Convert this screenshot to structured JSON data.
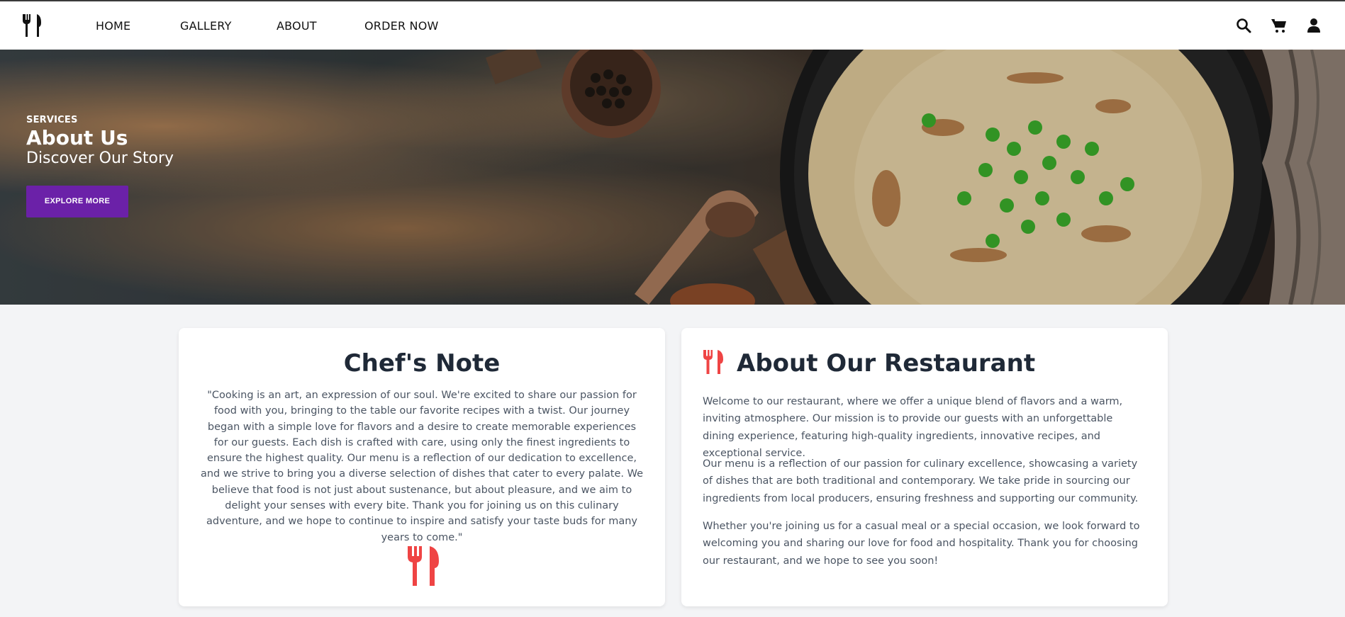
{
  "nav": {
    "logo": "fork-knife-logo",
    "links": [
      "HOME",
      "GALLERY",
      "ABOUT",
      "ORDER NOW"
    ],
    "icons": [
      "search-icon",
      "cart-icon",
      "user-icon"
    ]
  },
  "hero": {
    "eyebrow": "SERVICES",
    "title": "About Us",
    "subtitle": "Discover Our Story",
    "button_label": "EXPLORE MORE"
  },
  "chef_note": {
    "title": "Chef's Note",
    "text": "\"Cooking is an art, an expression of our soul. We're excited to share our passion for food with you, bringing to the table our favorite recipes with a twist. Our journey began with a simple love for flavors and a desire to create memorable experiences for our guests. Each dish is crafted with care, using only the finest ingredients to ensure the highest quality. Our menu is a reflection of our dedication to excellence, and we strive to bring you a diverse selection of dishes that cater to every palate. We believe that food is not just about sustenance, but about pleasure, and we aim to delight your senses with every bite. Thank you for joining us on this culinary adventure, and we hope to continue to inspire and satisfy your taste buds for many years to come.\"",
    "icon": "utensils-icon"
  },
  "about": {
    "title": "About Our Restaurant",
    "paragraphs": [
      "Welcome to our restaurant, where we offer a unique blend of flavors and a warm, inviting atmosphere. Our mission is to provide our guests with an unforgettable dining experience, featuring high-quality ingredients, innovative recipes, and exceptional service.",
      "Our menu is a reflection of our passion for culinary excellence, showcasing a variety of dishes that are both traditional and contemporary. We take pride in sourcing our ingredients from local producers, ensuring freshness and supporting our community.",
      "Whether you're joining us for a casual meal or a special occasion, we look forward to welcoming you and sharing our love for food and hospitality. Thank you for choosing our restaurant, and we hope to see you soon!"
    ],
    "icon": "utensils-icon"
  },
  "colors": {
    "accent": "#6b21a8",
    "icon_red": "#ef4444",
    "text_dark": "#1f2937",
    "text_muted": "#4b5563",
    "page_bg": "#f3f4f6"
  }
}
